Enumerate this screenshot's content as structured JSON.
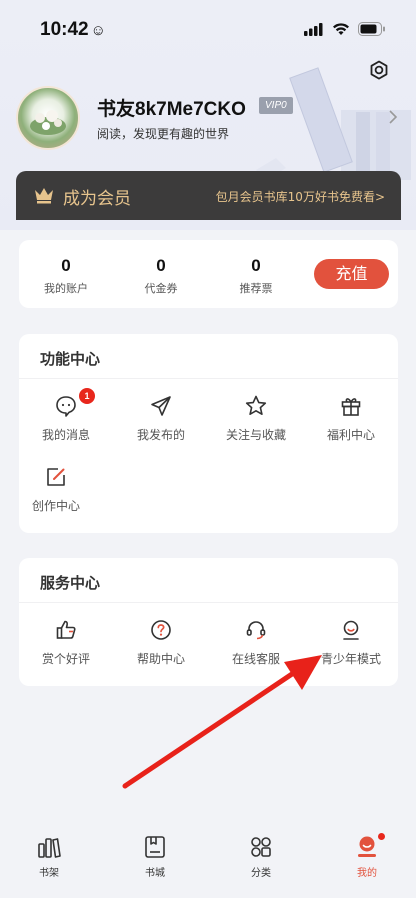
{
  "status_bar": {
    "time": "10:42",
    "time_emoji": "☺"
  },
  "profile": {
    "username": "书友8k7Me7CKO",
    "vip_badge": "VIP0",
    "slogan": "阅读，发现更有趣的世界"
  },
  "member_banner": {
    "title": "成为会员",
    "subtitle": "包月会员书库10万好书免费看>"
  },
  "account": {
    "items": [
      {
        "value": "0",
        "label": "我的账户"
      },
      {
        "value": "0",
        "label": "代金券"
      },
      {
        "value": "0",
        "label": "推荐票"
      }
    ],
    "recharge_label": "充值"
  },
  "function_center": {
    "title": "功能中心",
    "items": [
      {
        "label": "我的消息",
        "icon": "message-icon",
        "badge": "1"
      },
      {
        "label": "我发布的",
        "icon": "paper-plane-icon"
      },
      {
        "label": "关注与收藏",
        "icon": "star-icon"
      },
      {
        "label": "福利中心",
        "icon": "gift-icon"
      },
      {
        "label": "创作中心",
        "icon": "edit-icon"
      }
    ]
  },
  "service_center": {
    "title": "服务中心",
    "items": [
      {
        "label": "赏个好评",
        "icon": "thumbs-up-icon"
      },
      {
        "label": "帮助中心",
        "icon": "help-icon"
      },
      {
        "label": "在线客服",
        "icon": "headset-icon"
      },
      {
        "label": "青少年模式",
        "icon": "teen-mode-icon"
      }
    ]
  },
  "tabbar": {
    "items": [
      {
        "label": "书架",
        "icon": "bookshelf-icon"
      },
      {
        "label": "书城",
        "icon": "bookstore-icon"
      },
      {
        "label": "分类",
        "icon": "category-icon"
      },
      {
        "label": "我的",
        "icon": "profile-icon",
        "active": true
      }
    ]
  },
  "colors": {
    "accent": "#e2523d",
    "member_gold": "#e7c48d",
    "member_bg": "#3c3b3b",
    "annotation_arrow": "#e8221a"
  }
}
